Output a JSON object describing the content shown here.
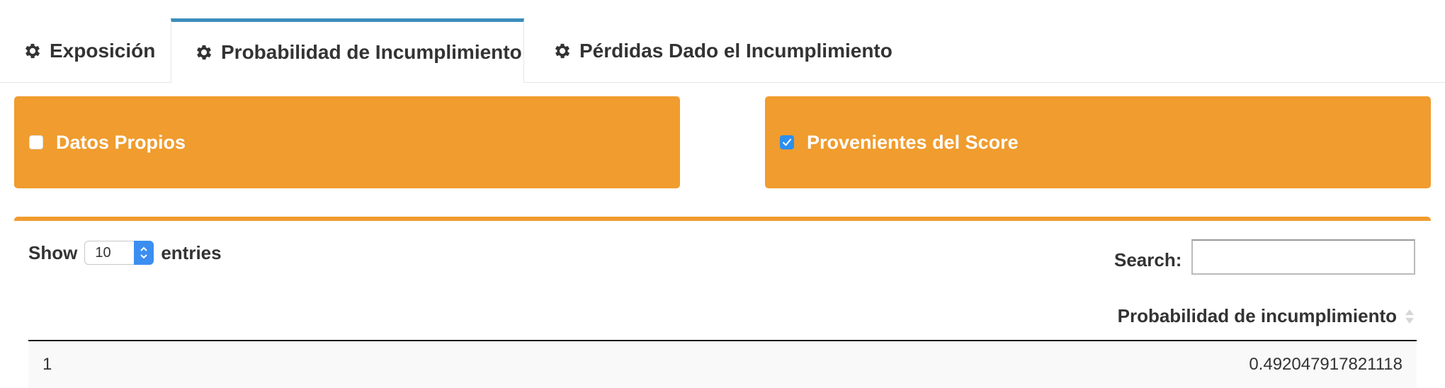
{
  "tabs": [
    {
      "label": "Exposición",
      "icon": "gear-icon",
      "active": false
    },
    {
      "label": "Probabilidad de Incumplimiento",
      "icon": "gear-icon",
      "active": true
    },
    {
      "label": "Pérdidas Dado el Incumplimiento",
      "icon": "gear-icon",
      "active": false
    }
  ],
  "options": {
    "datos_propios": {
      "label": "Datos Propios",
      "checked": false
    },
    "provenientes": {
      "label": "Provenientes del Score",
      "checked": true
    }
  },
  "table": {
    "show_label": "Show",
    "entries_value": "10",
    "entries_label": "entries",
    "search_label": "Search:",
    "search_value": "",
    "columns": [
      "Probabilidad de incumplimiento"
    ],
    "rows": [
      {
        "index": "1",
        "value": "0.492047917821118"
      }
    ]
  },
  "colors": {
    "accent_orange": "#f09c2e",
    "active_tab_border": "#3c8dbc",
    "checkbox_blue": "#2b8ff0"
  }
}
